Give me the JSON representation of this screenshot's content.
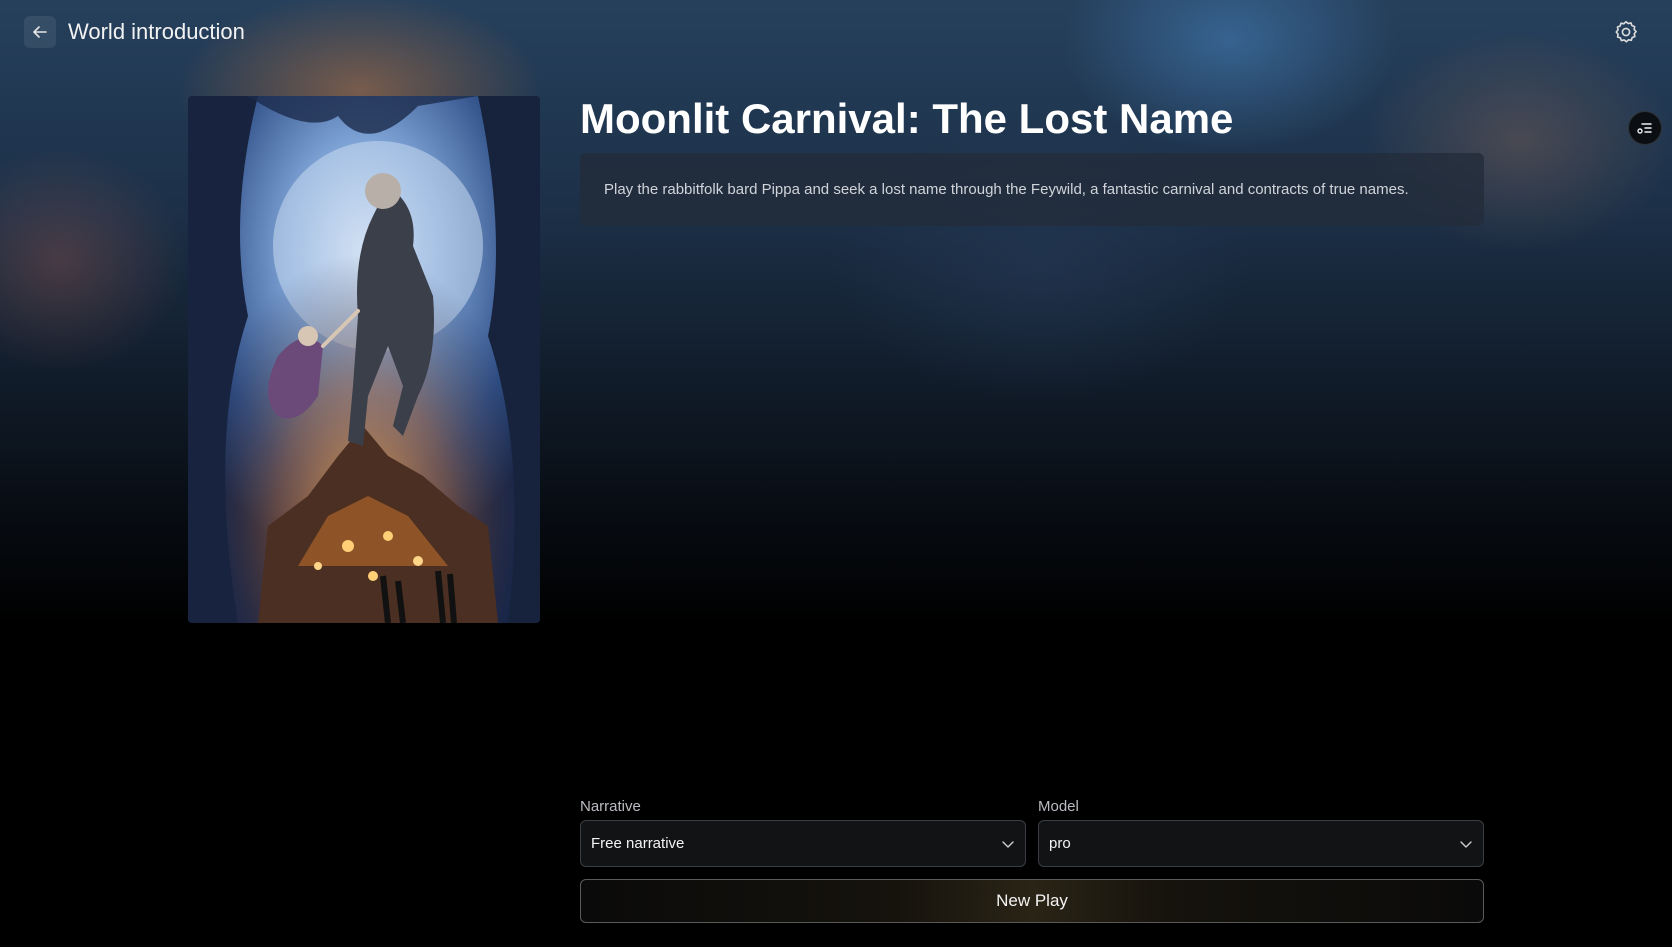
{
  "header": {
    "title": "World introduction",
    "back_icon": "arrow-left-icon",
    "settings_icon": "gear-icon"
  },
  "side_button": {
    "icon": "tune-list-icon"
  },
  "world": {
    "title": "Moonlit Carnival: The Lost Name",
    "description": "Play the rabbitfolk bard Pippa and seek a lost name through the Feywild, a fantastic carnival and contracts of true names."
  },
  "form": {
    "narrative": {
      "label": "Narrative",
      "value": "Free narrative"
    },
    "model": {
      "label": "Model",
      "value": "pro"
    },
    "new_play_label": "New Play"
  },
  "colors": {
    "background": "#000000",
    "panel": "#222c3a",
    "accent_gold": "#2a2416"
  }
}
